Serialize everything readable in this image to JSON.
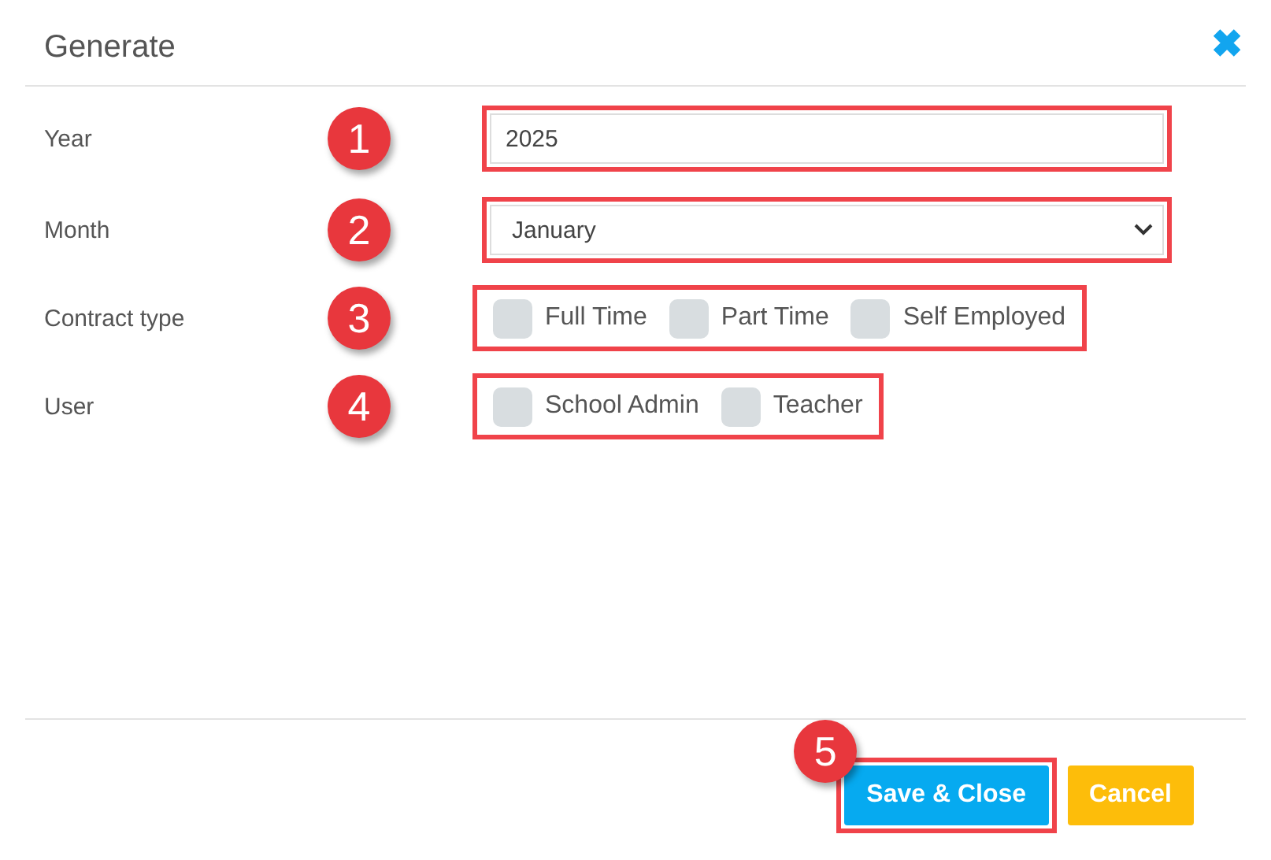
{
  "dialog": {
    "title": "Generate",
    "close_icon": "✖"
  },
  "fields": [
    {
      "kind": "text",
      "label": "Year",
      "marker": "1",
      "value": "2025"
    },
    {
      "kind": "select",
      "label": "Month",
      "marker": "2",
      "value": "January"
    },
    {
      "kind": "checkboxes",
      "label": "Contract type",
      "marker": "3",
      "options": [
        {
          "label": "Full Time",
          "checked": false
        },
        {
          "label": "Part Time",
          "checked": false
        },
        {
          "label": "Self Employed",
          "checked": false
        }
      ]
    },
    {
      "kind": "checkboxes",
      "label": "User",
      "marker": "4",
      "options": [
        {
          "label": "School Admin",
          "checked": false
        },
        {
          "label": "Teacher",
          "checked": false
        }
      ]
    }
  ],
  "buttons": [
    {
      "kind": "primary",
      "label": "Save & Close",
      "marker": "5"
    },
    {
      "kind": "warning",
      "label": "Cancel"
    }
  ]
}
